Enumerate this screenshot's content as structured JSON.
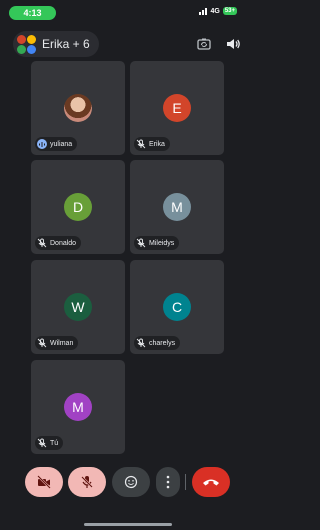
{
  "status_bar": {
    "time": "4:13",
    "network": "4G",
    "battery": "53+"
  },
  "header": {
    "meeting_title": "Erika + 6"
  },
  "participants": [
    {
      "name": "yuliana",
      "initial": "",
      "avatar_color": "#c98a7a",
      "muted": false,
      "speaking": true
    },
    {
      "name": "Erika",
      "initial": "E",
      "avatar_color": "#d2452a",
      "muted": true,
      "speaking": false
    },
    {
      "name": "Donaldo",
      "initial": "D",
      "avatar_color": "#689f38",
      "muted": true,
      "speaking": false
    },
    {
      "name": "Mileidys",
      "initial": "M",
      "avatar_color": "#78909c",
      "muted": true,
      "speaking": false
    },
    {
      "name": "Wilman",
      "initial": "W",
      "avatar_color": "#1b5e3f",
      "muted": true,
      "speaking": false
    },
    {
      "name": "charelys",
      "initial": "C",
      "avatar_color": "#00838f",
      "muted": true,
      "speaking": false
    },
    {
      "name": "Tú",
      "initial": "M",
      "avatar_color": "#a142c4",
      "muted": true,
      "speaking": false
    }
  ],
  "controls": [
    "camera-off",
    "mic-off",
    "reactions",
    "more-options",
    "end-call"
  ],
  "colors": {
    "background": "#1c1d21",
    "tile": "#35363a",
    "accent_red": "#f2b8b5",
    "end_call": "#d93025",
    "speaking": "#8ab4f8"
  }
}
